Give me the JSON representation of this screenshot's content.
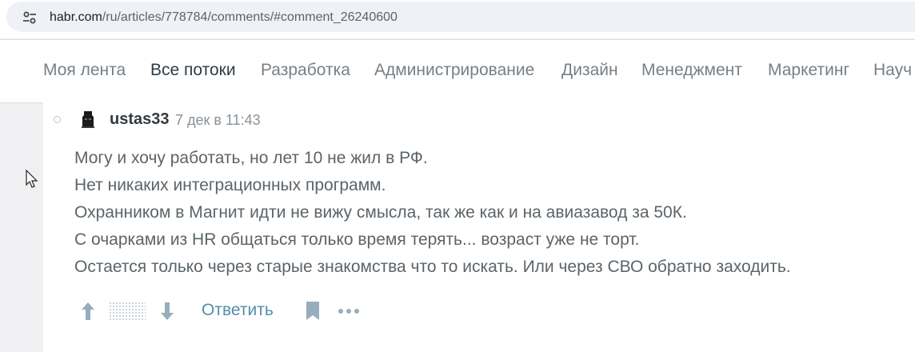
{
  "browser": {
    "url_host": "habr.com",
    "url_path": "/ru/articles/778784/comments/#comment_26240600",
    "site_info_icon": "tune-icon"
  },
  "nav": {
    "items": [
      {
        "label": "Моя лента",
        "active": false
      },
      {
        "label": "Все потоки",
        "active": true
      },
      {
        "label": "Разработка",
        "active": false
      },
      {
        "label": "Администрирование",
        "active": false
      },
      {
        "label": "Дизайн",
        "active": false
      },
      {
        "label": "Менеджмент",
        "active": false
      },
      {
        "label": "Маркетинг",
        "active": false
      },
      {
        "label": "Науч",
        "active": false
      }
    ]
  },
  "comment": {
    "username": "ustas33",
    "time": "7 дек в 11:43",
    "lines": [
      "Могу и хочу работать, но лет 10 не жил в РФ.",
      "Нет никаких интеграционных программ.",
      "Охранником в Магнит идти не вижу смысла, так же как и на авиазавод за 50К.",
      "С очарками из HR общаться только время терять... возраст уже не торт.",
      "Остается только через старые знакомства что то искать. Или через СВО обратно заходить."
    ],
    "actions": {
      "reply_label": "Ответить",
      "icons": [
        "arrow-up-icon",
        "arrow-down-icon",
        "bookmark-icon",
        "more-icon"
      ]
    }
  },
  "colors": {
    "accent_link": "#548eaa",
    "text_body": "#5c6469",
    "nav_inactive": "#777f86",
    "nav_active": "#303b44"
  }
}
